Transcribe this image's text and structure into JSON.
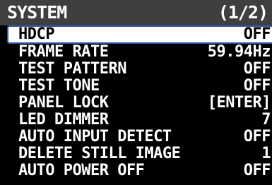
{
  "header": {
    "title": "SYSTEM",
    "page": "(1/2)"
  },
  "menu": {
    "items": [
      {
        "label": "HDCP",
        "value": "OFF",
        "selected": true
      },
      {
        "label": "FRAME RATE",
        "value": "59.94Hz"
      },
      {
        "label": "TEST PATTERN",
        "value": "OFF"
      },
      {
        "label": "TEST TONE",
        "value": "OFF"
      },
      {
        "label": "PANEL LOCK",
        "value": "[ENTER]"
      },
      {
        "label": "LED DIMMER",
        "value": "7"
      },
      {
        "label": "AUTO INPUT DETECT",
        "value": "OFF"
      },
      {
        "label": "DELETE STILL IMAGE",
        "value": "1"
      },
      {
        "label": "AUTO POWER OFF",
        "value": "OFF"
      }
    ]
  },
  "colors": {
    "background": "#000000",
    "header_bar": "#3f3f3f",
    "text": "#ffffff",
    "cursor_fill": "#ffffff",
    "cursor_border": "#2f58a8",
    "cursor_text": "#000000"
  }
}
